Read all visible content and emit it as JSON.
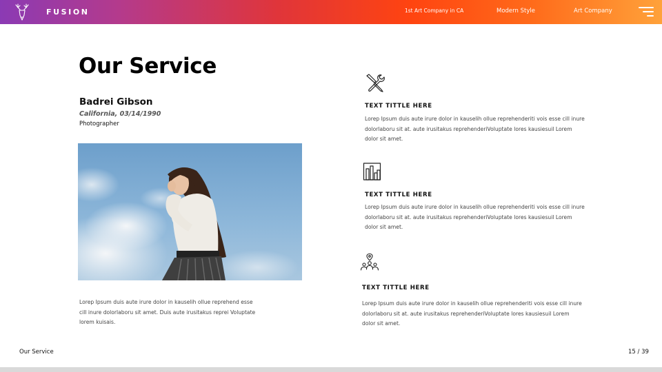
{
  "header": {
    "brand": "FUSION",
    "logo_icon": "deer-head-icon",
    "nav": [
      "1st Art Company in CA",
      "Modern Style",
      "Art Company"
    ],
    "menu_icon": "hamburger-menu-icon",
    "gradient_colors": [
      "#8b3ab4",
      "#e0353a",
      "#ff4410",
      "#ffa23a"
    ]
  },
  "main": {
    "title": "Our Service",
    "person": {
      "name": "Badrei Gibson",
      "meta": "California, 03/14/1990",
      "role": "Photographer"
    },
    "photo": {
      "subject": "woman-portrait-photo"
    },
    "description": "Lorep  Ipsum duis aute irure dolor in kauselih ollue reprehend esse cill inure dolorlaboru sit amet. Duis aute irusitakus reprei Voluptate lorem kuisais."
  },
  "services": [
    {
      "icon": "tools-icon",
      "title": "TEXT TITTLE HERE",
      "text": "Lorep  Ipsum duis aute irure dolor in kauselih ollue reprehenderiti vois esse cill inure dolorlaboru sit at. aute irusitakus reprehenderiVoluptate lores kausiesuil Lorem dolor sit amet."
    },
    {
      "icon": "bar-chart-icon",
      "title": "TEXT TITTLE HERE",
      "text": "Lorep  Ipsum duis aute irure dolor in kauselih ollue reprehenderiti vois esse cill inure dolorlaboru sit at. aute irusitakus reprehenderiVoluptate lores kausiesuil Lorem dolor sit amet."
    },
    {
      "icon": "team-location-icon",
      "title": "TEXT TITTLE HERE",
      "text": "Lorep  Ipsum duis aute irure dolor in kauselih ollue reprehenderiti vois esse cill inure dolorlaboru sit at. aute irusitakus reprehenderiVoluptate lores kausiesuil Lorem dolor sit amet."
    }
  ],
  "footer": {
    "label": "Our Service",
    "page": "15 / 39"
  }
}
